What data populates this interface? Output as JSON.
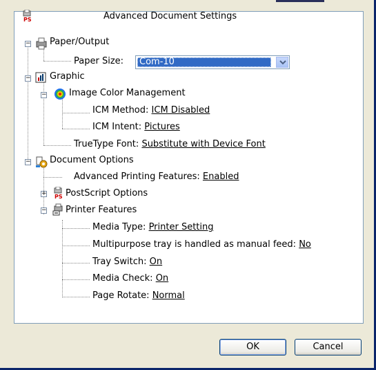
{
  "root_title": "Advanced Document Settings",
  "paper_output": {
    "label": "Paper/Output",
    "paper_size_label": "Paper Size:",
    "paper_size_value": "Com-10"
  },
  "graphic": {
    "label": "Graphic",
    "icm": {
      "label": "Image Color Management",
      "method_label": "ICM Method:",
      "method_value": "ICM Disabled",
      "intent_label": "ICM Intent:",
      "intent_value": "Pictures"
    },
    "truetype_label": "TrueType Font:",
    "truetype_value": "Substitute with Device Font"
  },
  "document_options": {
    "label": "Document Options",
    "adv_printing_label": "Advanced Printing Features:",
    "adv_printing_value": "Enabled",
    "postscript_label": "PostScript Options",
    "printer_features": {
      "label": "Printer Features",
      "media_type_label": "Media Type:",
      "media_type_value": "Printer Setting",
      "multipurpose_label": "Multipurpose tray is handled as manual feed:",
      "multipurpose_value": "No",
      "tray_switch_label": "Tray Switch:",
      "tray_switch_value": "On",
      "media_check_label": "Media Check:",
      "media_check_value": "On",
      "page_rotate_label": "Page Rotate:",
      "page_rotate_value": "Normal"
    }
  },
  "buttons": {
    "ok": "OK",
    "cancel": "Cancel"
  },
  "icons": [
    "printer-ps-icon",
    "printer-icon",
    "chart-icon",
    "color-target-icon",
    "gear-docs-icon",
    "printer-ps-icon",
    "printer-features-icon"
  ]
}
